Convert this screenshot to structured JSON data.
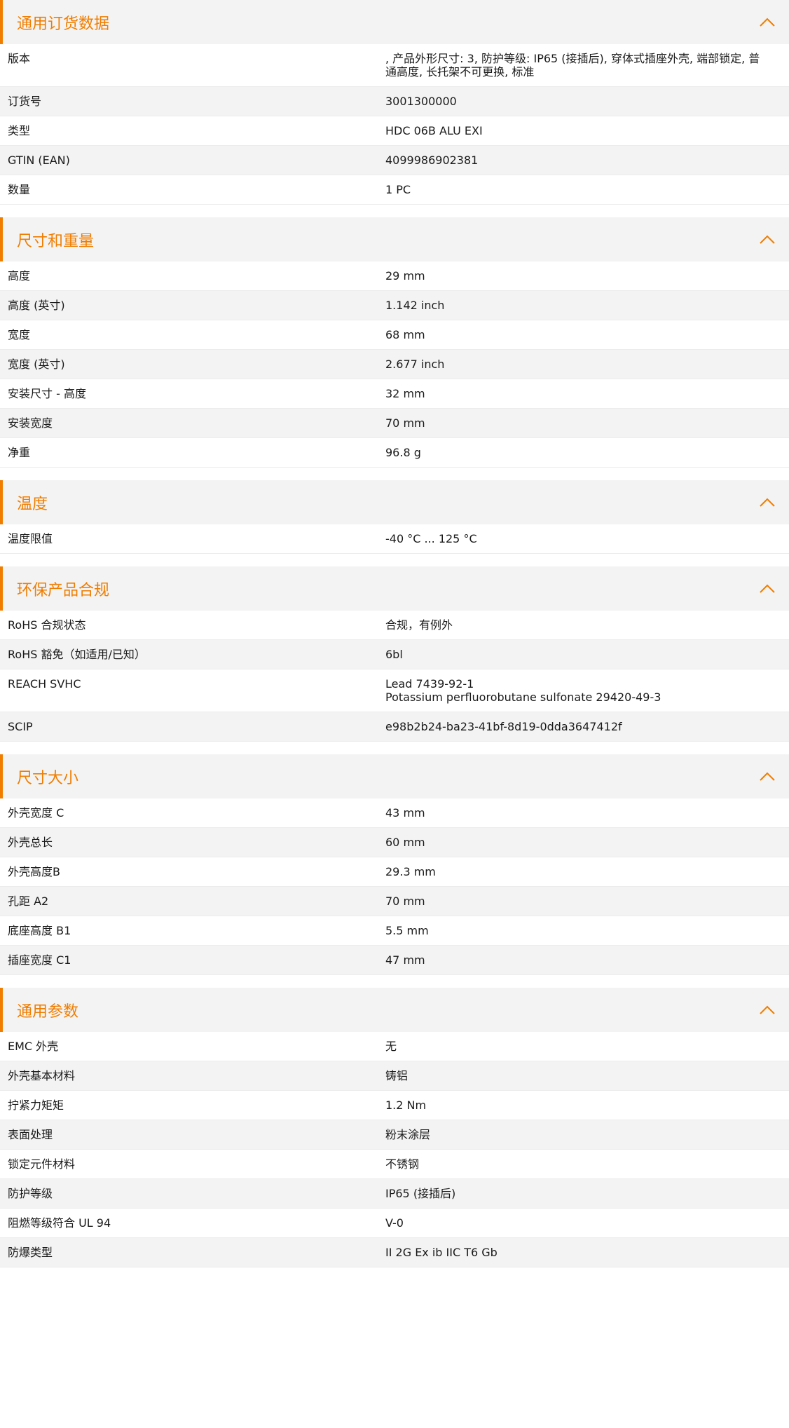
{
  "colors": {
    "accent": "#f07d00",
    "row_alt": "#f3f3f3"
  },
  "toggle_icon": "chevron-up-icon",
  "sections": [
    {
      "id": "general-order-data",
      "title": "通用订货数据",
      "rows": [
        {
          "label": "版本",
          "value": ", 产品外形尺寸: 3, 防护等级: IP65 (接插后), 穿体式插座外壳, 端部锁定, 普通高度, 长托架不可更换, 标准"
        },
        {
          "label": "订货号",
          "value": "3001300000"
        },
        {
          "label": "类型",
          "value": "HDC 06B ALU EXI"
        },
        {
          "label": "GTIN (EAN)",
          "value": "4099986902381"
        },
        {
          "label": "数量",
          "value": "1  PC"
        }
      ]
    },
    {
      "id": "dimensions-weight",
      "title": "尺寸和重量",
      "rows": [
        {
          "label": "高度",
          "value": "29  mm"
        },
        {
          "label": "高度 (英寸)",
          "value": "1.142  inch"
        },
        {
          "label": "宽度",
          "value": "68  mm"
        },
        {
          "label": "宽度 (英寸)",
          "value": "2.677  inch"
        },
        {
          "label": "安装尺寸 - 高度",
          "value": "32  mm"
        },
        {
          "label": "安装宽度",
          "value": "70  mm"
        },
        {
          "label": "净重",
          "value": "96.8  g"
        }
      ]
    },
    {
      "id": "temperature",
      "title": "温度",
      "rows": [
        {
          "label": "温度限值",
          "value": "-40 °C ... 125 °C"
        }
      ]
    },
    {
      "id": "environmental-compliance",
      "title": "环保产品合规",
      "rows": [
        {
          "label": "RoHS 合规状态",
          "value": "合规，有例外"
        },
        {
          "label": "RoHS 豁免（如适用/已知）",
          "value": "6bl"
        },
        {
          "label": "REACH SVHC",
          "value": "Lead 7439-92-1\nPotassium perfluorobutane sulfonate 29420-49-3"
        },
        {
          "label": "SCIP",
          "value": "e98b2b24-ba23-41bf-8d19-0dda3647412f"
        }
      ]
    },
    {
      "id": "size",
      "title": "尺寸大小",
      "rows": [
        {
          "label": "外壳宽度 C",
          "value": "43  mm"
        },
        {
          "label": "外壳总长",
          "value": "60  mm"
        },
        {
          "label": "外壳高度B",
          "value": "29.3  mm"
        },
        {
          "label": "孔距 A2",
          "value": "70  mm"
        },
        {
          "label": "底座高度 B1",
          "value": "5.5  mm"
        },
        {
          "label": "插座宽度 C1",
          "value": "47  mm"
        }
      ]
    },
    {
      "id": "general-parameters",
      "title": "通用参数",
      "rows": [
        {
          "label": "EMC 外壳",
          "value": "无"
        },
        {
          "label": "外壳基本材料",
          "value": "铸铝"
        },
        {
          "label": "拧紧力矩矩",
          "value": "1.2  Nm"
        },
        {
          "label": "表面处理",
          "value": "粉末涂层"
        },
        {
          "label": "锁定元件材料",
          "value": "不锈钢"
        },
        {
          "label": "防护等级",
          "value": "IP65 (接插后)"
        },
        {
          "label": "阻燃等级符合 UL 94",
          "value": "V-0"
        },
        {
          "label": "防爆类型",
          "value": "II 2G Ex ib IIC T6 Gb"
        }
      ]
    }
  ]
}
